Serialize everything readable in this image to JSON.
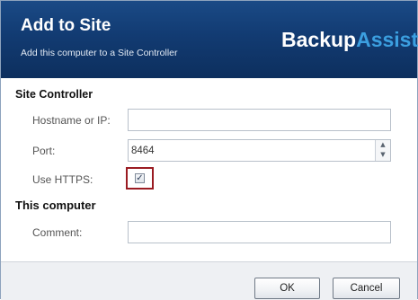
{
  "header": {
    "title": "Add to Site",
    "subtitle": "Add this computer to a Site Controller",
    "brand_primary": "Backup",
    "brand_secondary": "Assist",
    "brand_tm": "™",
    "colors": {
      "header_bg": "#123b72",
      "brand_accent": "#3b9fe0",
      "highlight": "#9a1b22"
    }
  },
  "site_controller": {
    "heading": "Site Controller",
    "hostname_label": "Hostname or IP:",
    "hostname_value": "",
    "port_label": "Port:",
    "port_value": "8464",
    "https_label": "Use HTTPS:",
    "https_checked": true,
    "https_check_glyph": "✓",
    "spin_up_icon": "▲",
    "spin_down_icon": "▼"
  },
  "this_computer": {
    "heading": "This computer",
    "comment_label": "Comment:",
    "comment_value": ""
  },
  "footer": {
    "ok_label": "OK",
    "cancel_label": "Cancel"
  }
}
